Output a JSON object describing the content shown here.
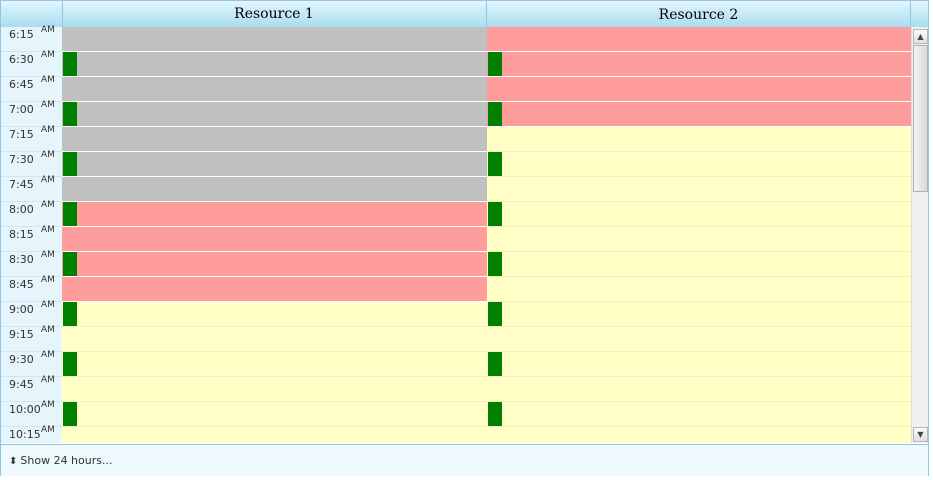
{
  "header": {
    "resources": [
      "Resource 1",
      "Resource 2"
    ]
  },
  "times": [
    {
      "t": "6:15",
      "ap": "AM"
    },
    {
      "t": "6:30",
      "ap": "AM"
    },
    {
      "t": "6:45",
      "ap": "AM"
    },
    {
      "t": "7:00",
      "ap": "AM"
    },
    {
      "t": "7:15",
      "ap": "AM"
    },
    {
      "t": "7:30",
      "ap": "AM"
    },
    {
      "t": "7:45",
      "ap": "AM"
    },
    {
      "t": "8:00",
      "ap": "AM"
    },
    {
      "t": "8:15",
      "ap": "AM"
    },
    {
      "t": "8:30",
      "ap": "AM"
    },
    {
      "t": "8:45",
      "ap": "AM"
    },
    {
      "t": "9:00",
      "ap": "AM"
    },
    {
      "t": "9:15",
      "ap": "AM"
    },
    {
      "t": "9:30",
      "ap": "AM"
    },
    {
      "t": "9:45",
      "ap": "AM"
    },
    {
      "t": "10:00",
      "ap": "AM"
    },
    {
      "t": "10:15",
      "ap": "AM"
    }
  ],
  "slot_status": {
    "resource_1": [
      "gray",
      "gray",
      "gray",
      "gray",
      "gray",
      "gray",
      "gray",
      "red",
      "red",
      "red",
      "red",
      "yellow",
      "yellow",
      "yellow",
      "yellow",
      "yellow",
      "yellow"
    ],
    "resource_2": [
      "red",
      "red",
      "red",
      "red",
      "yellow",
      "yellow",
      "yellow",
      "yellow",
      "yellow",
      "yellow",
      "yellow",
      "yellow",
      "yellow",
      "yellow",
      "yellow",
      "yellow",
      "yellow"
    ]
  },
  "marker_rows": [
    1,
    3,
    5,
    7,
    9,
    11,
    13,
    15
  ],
  "colors": {
    "gray": "#c0c0c0",
    "red": "#ff9c9c",
    "yellow": "#ffffc6",
    "marker": "#008000",
    "header": "#a9ddf1"
  },
  "footer": {
    "show_label": "Show 24 hours...",
    "arrow_icon": "up-down-arrows-icon"
  }
}
